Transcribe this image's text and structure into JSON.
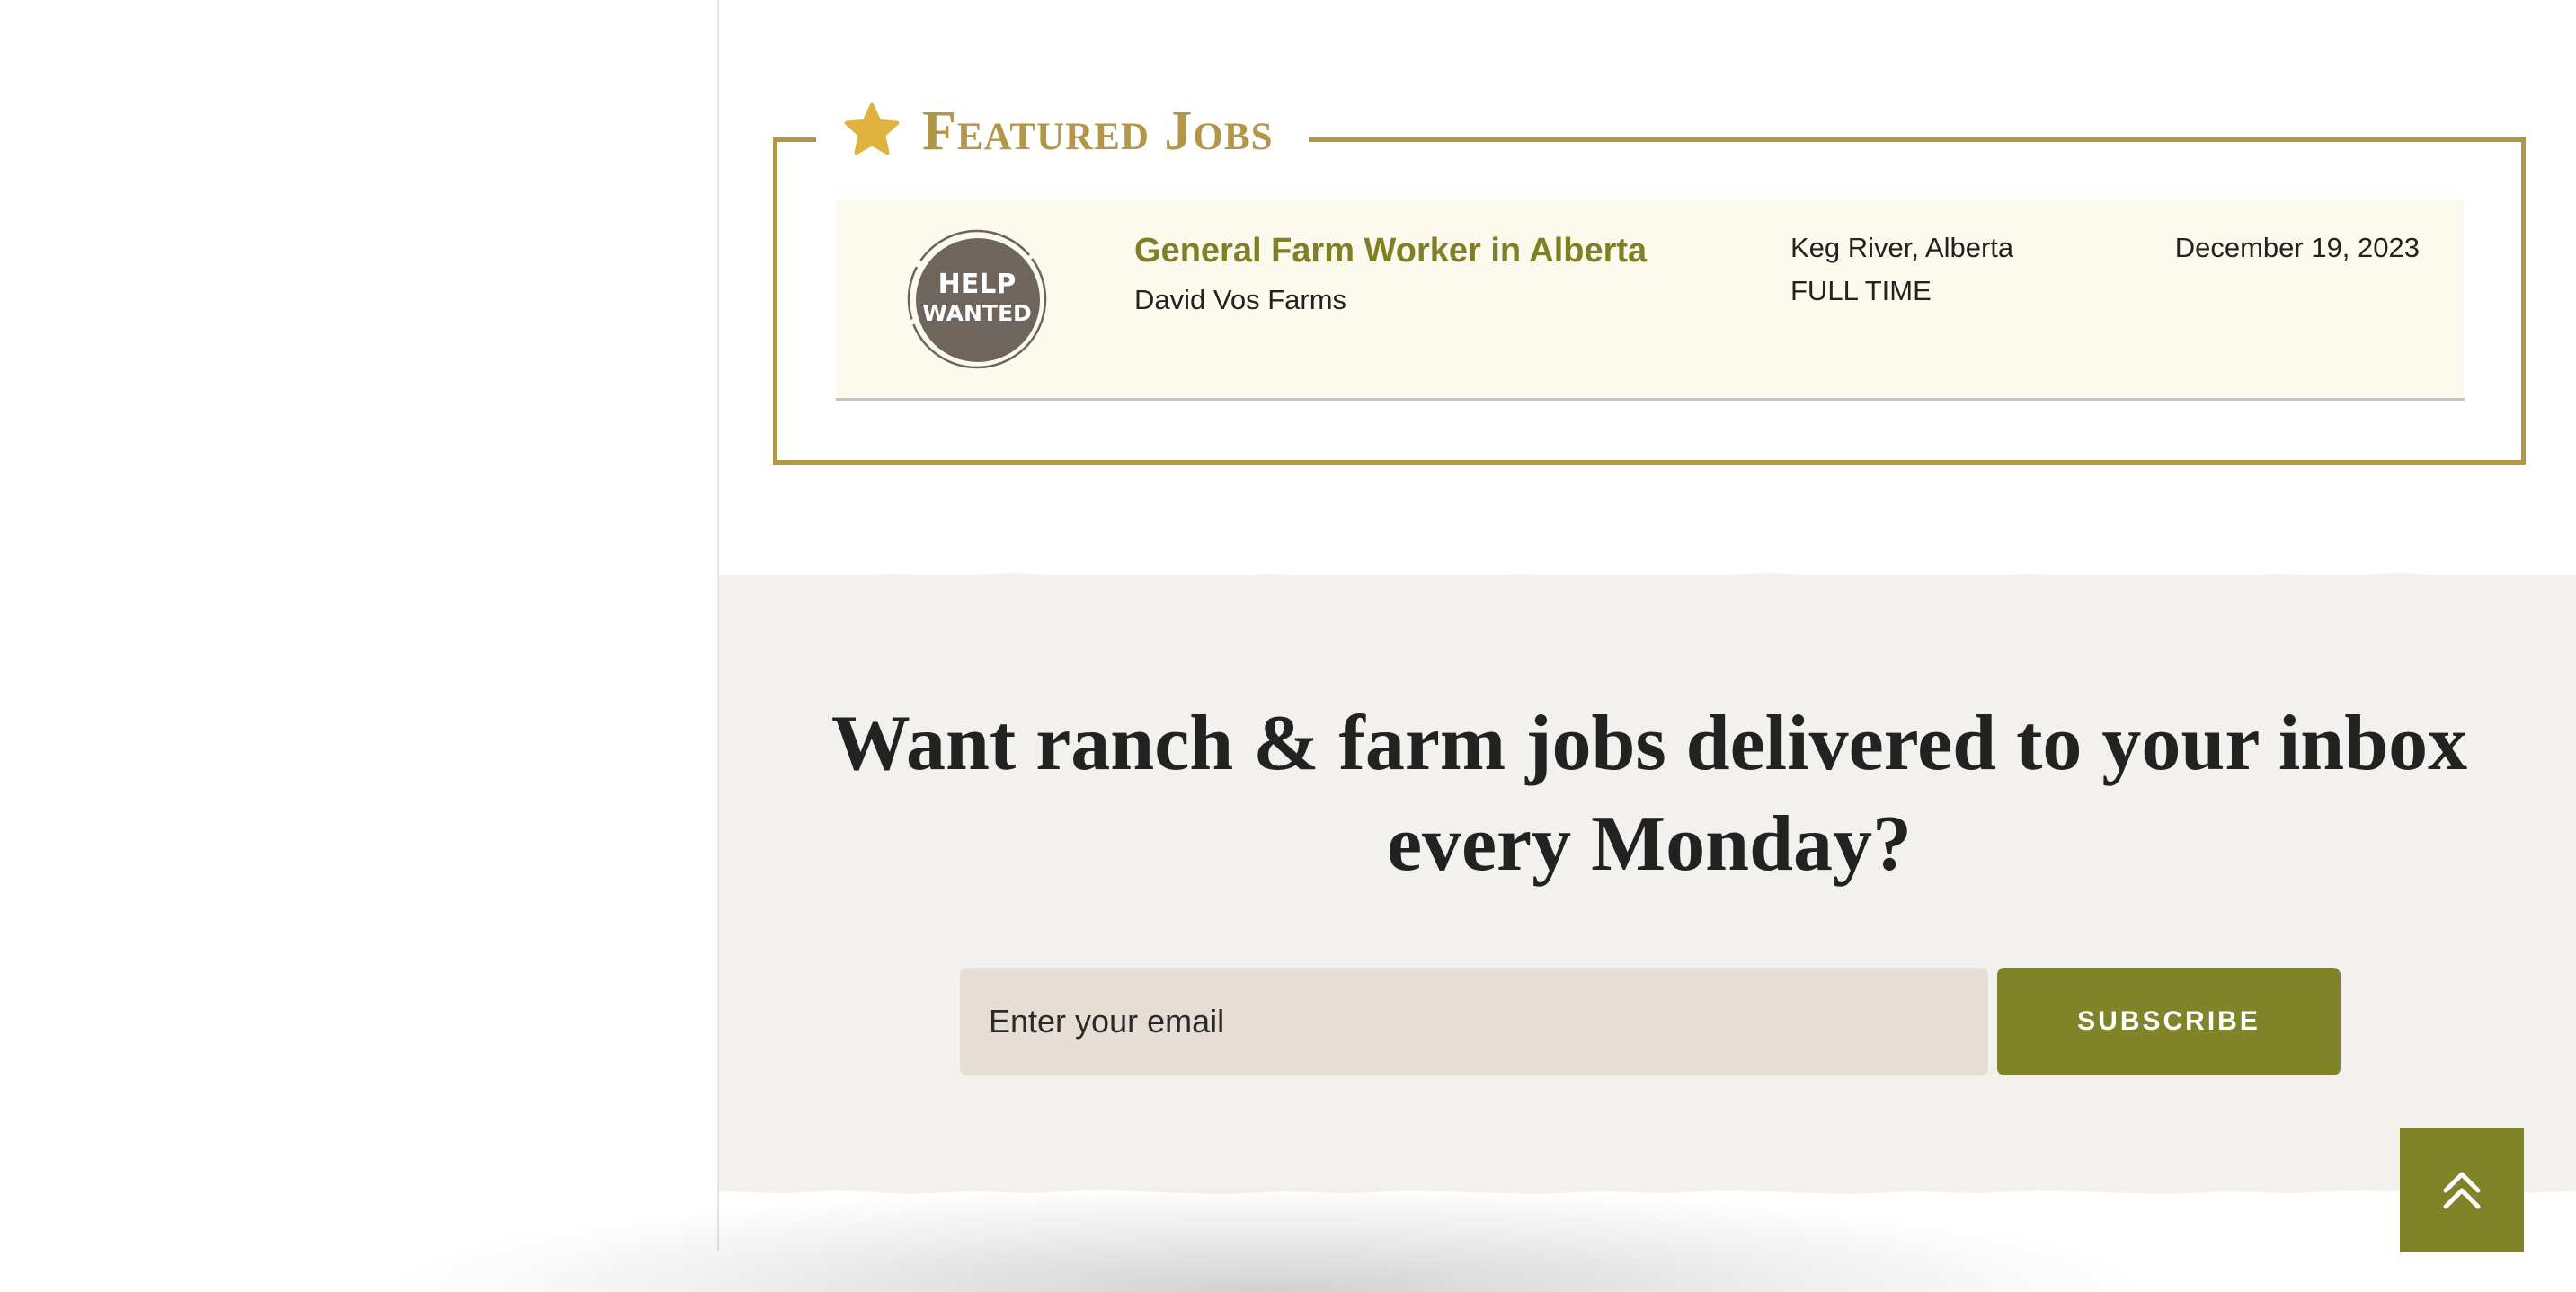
{
  "featured": {
    "title": "Featured Jobs",
    "icon": "star-icon",
    "jobs": [
      {
        "logo_text": "Help Wanted",
        "title": "General Farm Worker in Alberta",
        "company": "David Vos Farms",
        "location": "Keg River, Alberta",
        "type": "FULL TIME",
        "date": "December 19, 2023"
      }
    ]
  },
  "newsletter": {
    "heading": "Want ranch & farm jobs delivered to your inbox every Monday?",
    "email_placeholder": "Enter your email",
    "subscribe_label": "SUBSCRIBE"
  },
  "back_to_top": {
    "icon": "double-chevron-up-icon"
  },
  "colors": {
    "accent_gold": "#b19747",
    "olive": "#818329",
    "job_title": "#7f7f26",
    "job_row_bg": "#fbfaec",
    "band_bg": "#f3f1ed",
    "input_bg": "#e6ded5",
    "text": "#222222"
  }
}
